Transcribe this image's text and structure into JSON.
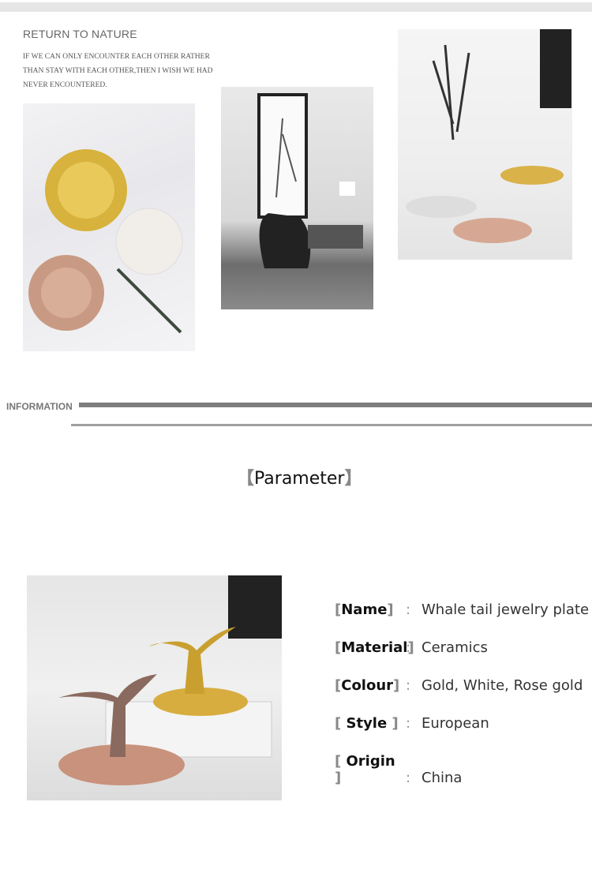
{
  "header": {
    "title": "RETURN TO NATURE",
    "quote": "IF WE CAN ONLY ENCOUNTER EACH OTHER RATHER THAN STAY WITH EACH OTHER,THEN I WISH WE HAD NEVER ENCOUNTERED."
  },
  "section": {
    "label": "INFORMATION"
  },
  "parameter": {
    "title": "Parameter",
    "open": "【",
    "close": "】",
    "rows": [
      {
        "label": "Name",
        "value": "Whale tail jewelry plate"
      },
      {
        "label": "Material",
        "value": "Ceramics"
      },
      {
        "label": "Colour",
        "value": "Gold, White, Rose gold"
      },
      {
        "label": "Style",
        "value": "European"
      },
      {
        "label": "Origin",
        "value": "China"
      }
    ],
    "separator": ":"
  },
  "colors": {
    "bar": "#7d7d7d",
    "text": "#666666"
  }
}
